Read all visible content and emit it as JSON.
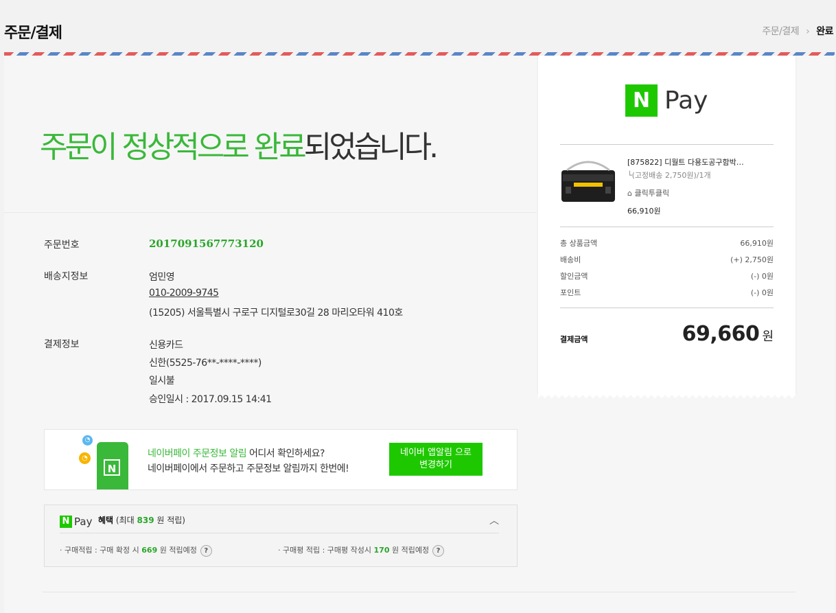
{
  "header": {
    "title": "주문/결제",
    "breadcrumb": [
      "주문/결제",
      "완료"
    ]
  },
  "hero": {
    "green_text": "주문이 정상적으로 완료",
    "rest_text": "되었습니다."
  },
  "order": {
    "order_number_label": "주문번호",
    "order_number": "2017091567773120",
    "shipping_label": "배송지정보",
    "recipient": "엄민영",
    "phone": "010-2009-9745",
    "address": "(15205) 서울특별시 구로구 디지털로30길 28 마리오타워 410호",
    "payment_label": "결제정보",
    "payment_method": "신용카드",
    "card": "신한(5525-76**-****-****)",
    "installment": "일시불",
    "approval": "승인일시 : 2017.09.15 14:41"
  },
  "alarm": {
    "line1_green": "네이버페이 주문정보 알림",
    "line1_rest": " 어디서 확인하세요?",
    "line2": "네이버페이에서 주문하고 주문정보 알림까지 한번에!",
    "button": "네이버 앱알림 으로\n변경하기"
  },
  "benefit": {
    "logo_letter": "N",
    "logo_text": "Pay",
    "title": "혜택",
    "title_pre": " (최대 ",
    "max_points": "839",
    "title_post": " 원 적립)",
    "item1_pre": "· 구매적립 : 구매 확정 시 ",
    "item1_points": "669",
    "item1_post": " 원 적립예정",
    "item2_pre": "· 구매평 적립 : 구매평 작성시 ",
    "item2_points": "170",
    "item2_post": " 원 적립예정",
    "help": "?"
  },
  "receipt": {
    "logo_letter": "N",
    "logo_text": "Pay",
    "product_name": "[875822] 디월트 다용도공구함박…",
    "product_shipping": "└(고정배송 2,750원)/1개",
    "store": "클릭투클릭",
    "product_price": "66,910원",
    "summary": [
      {
        "label": "총 상품금액",
        "value": "66,910원"
      },
      {
        "label": "배송비",
        "value": "(+) 2,750원"
      },
      {
        "label": "할인금액",
        "value": "(-) 0원"
      },
      {
        "label": "포인트",
        "value": "(-) 0원"
      }
    ],
    "pay_label": "결제금액",
    "pay_total": "69,660",
    "currency": "원"
  },
  "colors": {
    "green": "#1ec800",
    "text_green": "#3ab83a"
  }
}
